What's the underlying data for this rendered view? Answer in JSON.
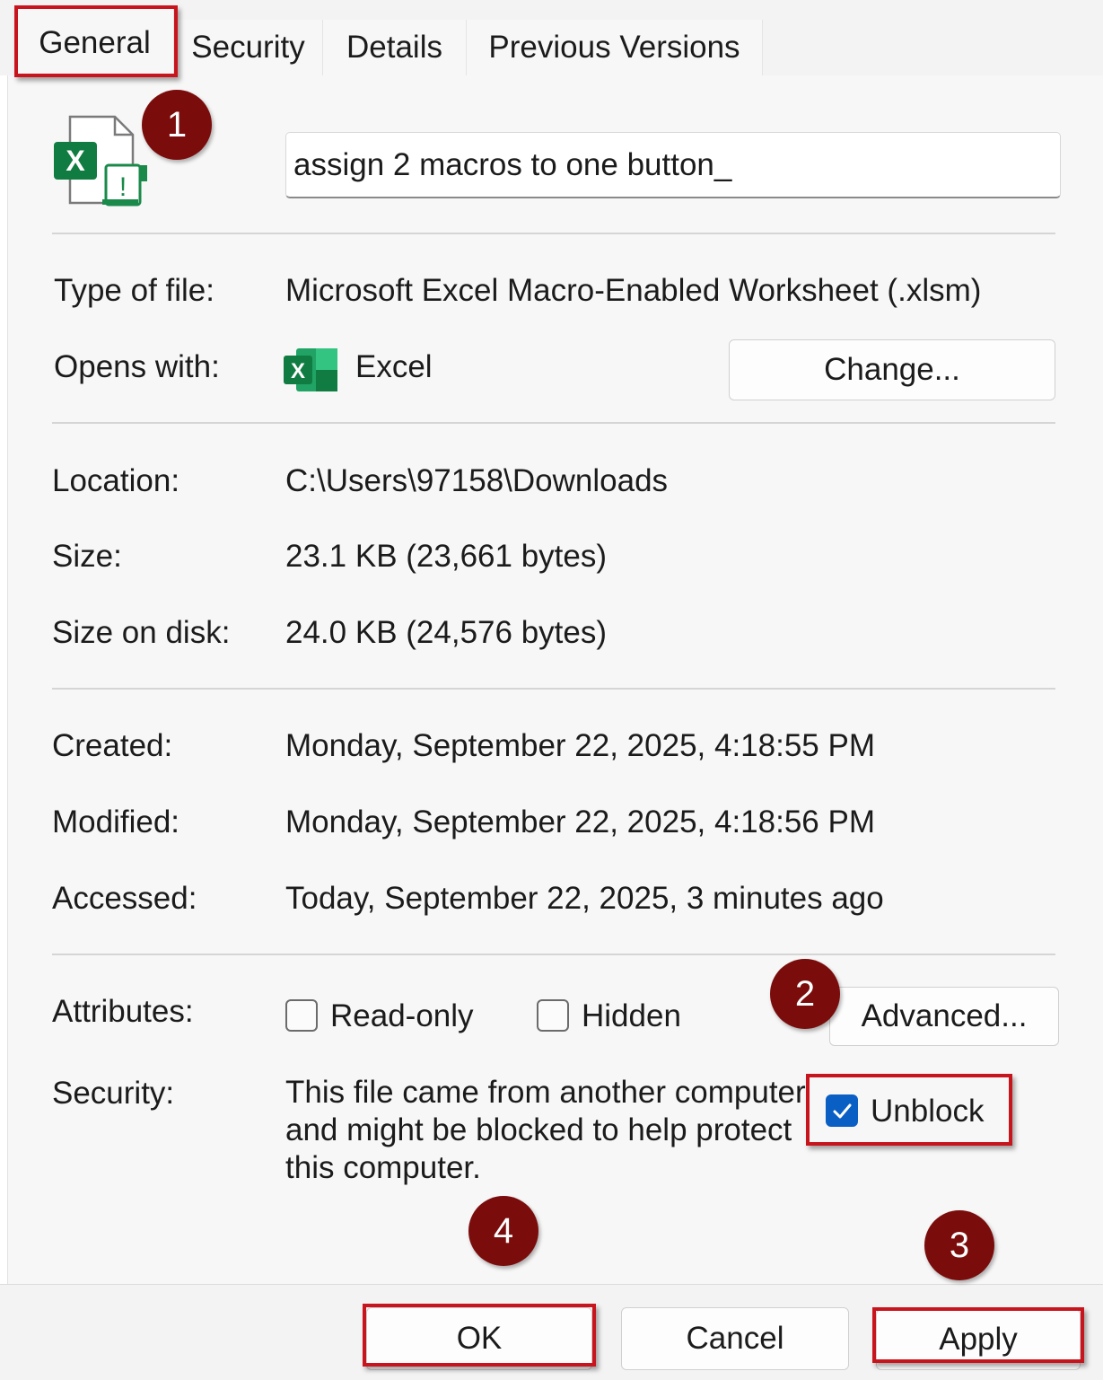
{
  "tabs": [
    {
      "label": "General",
      "active": true
    },
    {
      "label": "Security"
    },
    {
      "label": "Details"
    },
    {
      "label": "Previous Versions"
    }
  ],
  "file": {
    "name": "assign 2 macros to one button_",
    "icon": "excel-file-blocked-icon"
  },
  "rows": {
    "type_label": "Type of file:",
    "type_value": "Microsoft Excel Macro-Enabled Worksheet (.xlsm)",
    "opens_label": "Opens with:",
    "opens_value": "Excel",
    "change_label": "Change...",
    "location_label": "Location:",
    "location_value": "C:\\Users\\97158\\Downloads",
    "size_label": "Size:",
    "size_value": "23.1 KB (23,661 bytes)",
    "disk_label": "Size on disk:",
    "disk_value": "24.0 KB (24,576 bytes)",
    "created_label": "Created:",
    "created_value": "Monday, September 22, 2025, 4:18:55 PM",
    "modified_label": "Modified:",
    "modified_value": "Monday, September 22, 2025, 4:18:56 PM",
    "accessed_label": "Accessed:",
    "accessed_value": "Today, September 22, 2025, 3 minutes ago"
  },
  "attributes": {
    "label": "Attributes:",
    "readonly_label": "Read-only",
    "readonly_checked": false,
    "hidden_label": "Hidden",
    "hidden_checked": false,
    "advanced_label": "Advanced..."
  },
  "security": {
    "label": "Security:",
    "line1": "This file came from another computer",
    "line2": "and might be blocked to help protect",
    "line3": "this computer.",
    "unblock_label": "Unblock",
    "unblock_checked": true
  },
  "buttons": {
    "ok": "OK",
    "cancel": "Cancel",
    "apply": "Apply"
  },
  "callouts": [
    "1",
    "2",
    "3",
    "4"
  ],
  "colors": {
    "callout": "#7b0c0c",
    "highlight": "#c8151d",
    "checkbox_accent": "#0a5fc4",
    "excel_green": "#107c41"
  }
}
